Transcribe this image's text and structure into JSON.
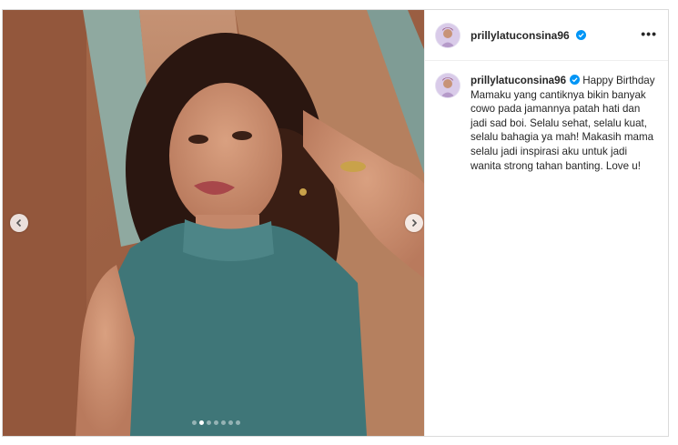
{
  "post": {
    "username": "prillylatuconsina96",
    "more_icon": "more-horizontal-icon",
    "caption": "Happy Birthday Mamaku yang cantiknya bikin banyak cowo pada jamannya patah hati dan jadi sad boi. Selalu sehat, selalu kuat, selalu bahagia ya mah! Makasih mama selalu jadi inspirasi aku untuk jadi wanita strong tahan banting. Love u!",
    "carousel": {
      "total": 7,
      "active_index": 1
    }
  },
  "colors": {
    "verified_blue": "#0095f6",
    "border": "#dbdbdb",
    "text": "#262626"
  }
}
